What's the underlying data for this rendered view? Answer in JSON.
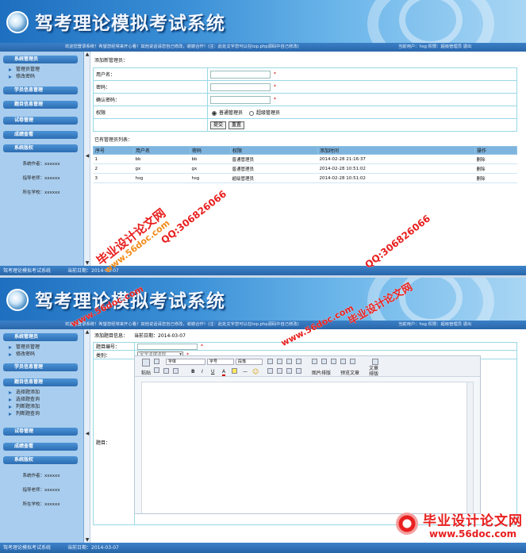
{
  "app": {
    "title": "驾考理论模拟考试系统",
    "notice": "欢迎您登录系统！希望您经常来开心看！其他说话请您自己修改，谢谢合作！(注：此处文字您可以在top.php源码中自己修改)",
    "user_info": "当前用户：hsg 权限：超级管理员 退出",
    "footer_title": "驾考理论模拟考试系统",
    "footer_date": "当前日期：2014-03-07"
  },
  "sidebar_a": {
    "menus": [
      "系统管理员",
      "学员信息管理",
      "题目信息管理",
      "试卷管理",
      "成绩查看",
      "系统版权"
    ],
    "subs": [
      "管理员管理",
      "修改密码"
    ],
    "info": [
      "系统作者：xxxxxx",
      "指导老师：xxxxxx",
      "所在学校：xxxxxx"
    ]
  },
  "sidebar_b": {
    "menus": [
      "系统管理员",
      "学员信息管理",
      "题目信息管理",
      "试卷管理",
      "成绩查看",
      "系统版权"
    ],
    "subs_admin": [
      "管理员管理",
      "修改密码"
    ],
    "subs_question": [
      "选择题添加",
      "选择题查询",
      "判断题添加",
      "判断题查询"
    ],
    "info": [
      "系统作者：xxxxxx",
      "指导老师：xxxxxx",
      "所在学校：xxxxxx"
    ]
  },
  "splitter": {
    "up": "▲",
    "mid": "◀",
    "down": "▼"
  },
  "admin_page": {
    "add_label": "添加新管理员：",
    "username_label": "用户名：",
    "password_label": "密码：",
    "confirm_label": "确认密码：",
    "permission_label": "权限",
    "perm_normal": "普通管理员",
    "perm_super": "超级管理员",
    "star": "*",
    "submit": "提交",
    "reset": "重置",
    "list_label": "已有管理员列表：",
    "columns": [
      "序号",
      "用户名",
      "密码",
      "权限",
      "添加时间",
      "操作"
    ],
    "rows": [
      [
        "1",
        "bb",
        "bb",
        "普通管理员",
        "2014-02-28 21:16:37",
        "删除"
      ],
      [
        "2",
        "gx",
        "gx",
        "普通管理员",
        "2014-02-28 10:51:02",
        "删除"
      ],
      [
        "3",
        "hsg",
        "hsg",
        "超级管理员",
        "2014-02-28 10:51:02",
        "删除"
      ]
    ]
  },
  "question_page": {
    "info_label": "添加题目信息：",
    "date": "当前日期：2014-03-07",
    "code_label": "题目编号：",
    "type_label": "类别：",
    "type_value": "安全法律法规",
    "content_label": "题目：",
    "star": "*"
  },
  "editor": {
    "paste": "粘贴",
    "font": "字体",
    "size": "字号",
    "para": "段落",
    "image_layout": "图片排版",
    "preset_layout": "预览文章",
    "text_layout": "文章排版",
    "bold": "B",
    "italic": "I",
    "underline": "U",
    "font_color": "A",
    "hr": "—",
    "emoticon": "☺"
  },
  "watermarks": {
    "site": "www.56doc.com",
    "brand": "毕业设计论文网",
    "qq": "QQ:306826066",
    "bottom_site": "www.56doc.com"
  },
  "colors": {
    "banner": "#2a7fcf",
    "sidebar": "#a9cdee",
    "menu": "#2c6db2",
    "table_header": "#7fb4de",
    "border": "#9ad8e6",
    "watermark_red": "#e8201f"
  }
}
